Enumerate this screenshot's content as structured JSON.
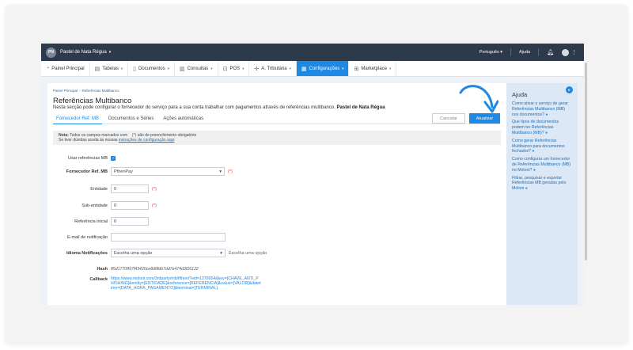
{
  "topbar": {
    "avatar_initials": "PN",
    "company": "Pastel de Nata Régua",
    "language": "Português",
    "help": "Ajuda"
  },
  "menu": [
    {
      "label": "Painel Principal",
      "icon": "gauge-icon"
    },
    {
      "label": "Tabelas",
      "icon": "table-icon"
    },
    {
      "label": "Documentos",
      "icon": "document-icon"
    },
    {
      "label": "Consultas",
      "icon": "chart-icon"
    },
    {
      "label": "POS",
      "icon": "cart-icon"
    },
    {
      "label": "A. Tributária",
      "icon": "tax-icon"
    },
    {
      "label": "Configurações",
      "icon": "gear-icon"
    },
    {
      "label": "Marketplace",
      "icon": "grid-icon"
    }
  ],
  "breadcrumb": {
    "home": "Painel Principal",
    "current": "Referências Multibanco"
  },
  "page": {
    "title": "Referências Multibanco",
    "subtitle": "Nesta secção pode configurar o fornecedor do serviço para a sua conta trabalhar com pagamentos através de referências multibanco.",
    "subtitle_company": "Pastel de Nata Régua"
  },
  "tabs": [
    "Fornecedor Ref. MB",
    "Documentos e Séries",
    "Ações automáticas"
  ],
  "buttons": {
    "cancel": "Cancelar",
    "update": "Atualizar"
  },
  "note": {
    "label": "Nota:",
    "text1": "Todos os campos marcados com",
    "required_mark": "(*)",
    "text2": "são de preenchimento obrigatório",
    "text3": "Se tiver dúvidas aceda às nossas",
    "link": "instruções de configuração aqui"
  },
  "form": {
    "use_mb_label": "Usar referências MB",
    "provider_label": "Fornecedor Ref. MB",
    "provider_value": "PthenPay",
    "entity_label": "Entidade",
    "entity_value": "0",
    "subentity_label": "Sub-entidade",
    "subentity_value": "0",
    "initial_ref_label": "Referência inicial",
    "initial_ref_value": "0",
    "email_label": "E-mail de notificação",
    "email_value": "",
    "language_label": "Idioma Notificações",
    "language_value": "Escolha uma opção",
    "language_hint": "Escolha uma opção",
    "hash_label": "Hash",
    "hash_value": "85d1770897f43420ce8d8fdb7dd7e474d3f26122",
    "callback_label": "Callback",
    "callback_value": "https://www.moloni.com/3rdparty/mb/ifthen/?eid=1379954&key=[CHAVE_ANTI_PHISHING]&entity=[ENTIDADE]&reference=[REFERENCIA]&value=[VALOR]&datetime=[DATA_HORA_PAGAMENTO]&terminal=[TERMINAL]",
    "required_mark": "(*)"
  },
  "help_panel": {
    "title": "Ajuda",
    "items": [
      "Como ativar o serviço de gerar Referências Multibanco (MB) nos documentos?",
      "Que tipos de documentos podem ter Referências Multibanco (MB)?",
      "Como gerar Referências Multibanco para documentos fechados?",
      "Como configurar um fornecedor de Referências Multibanco (MB) no Moloni?",
      "Filtrar, pesquisar e exportar Referências MB geradas pelo Moloni"
    ]
  },
  "colors": {
    "accent": "#1e88e5",
    "topbar": "#2c3a4b",
    "help_bg": "#dce8f5"
  }
}
